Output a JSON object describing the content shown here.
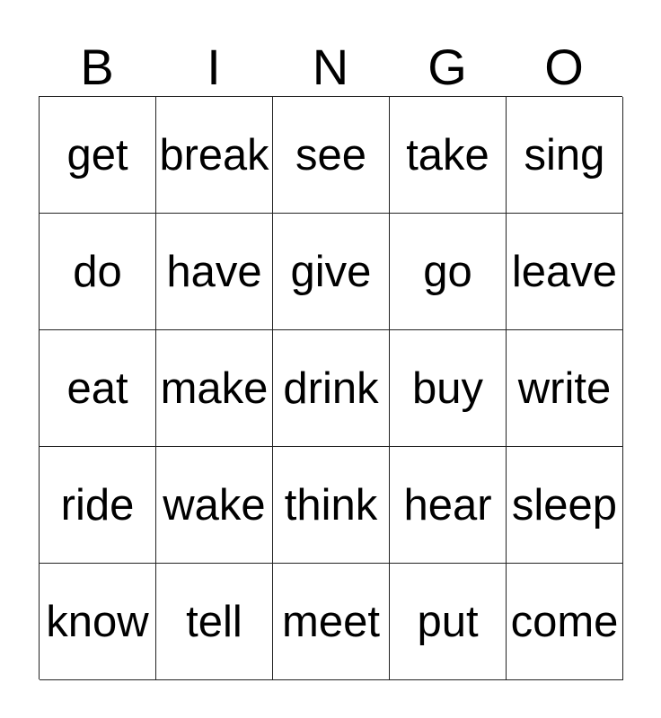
{
  "header": [
    "B",
    "I",
    "N",
    "G",
    "O"
  ],
  "rows": [
    [
      "get",
      "break",
      "see",
      "take",
      "sing"
    ],
    [
      "do",
      "have",
      "give",
      "go",
      "leave"
    ],
    [
      "eat",
      "make",
      "drink",
      "buy",
      "write"
    ],
    [
      "ride",
      "wake",
      "think",
      "hear",
      "sleep"
    ],
    [
      "know",
      "tell",
      "meet",
      "put",
      "come"
    ]
  ]
}
